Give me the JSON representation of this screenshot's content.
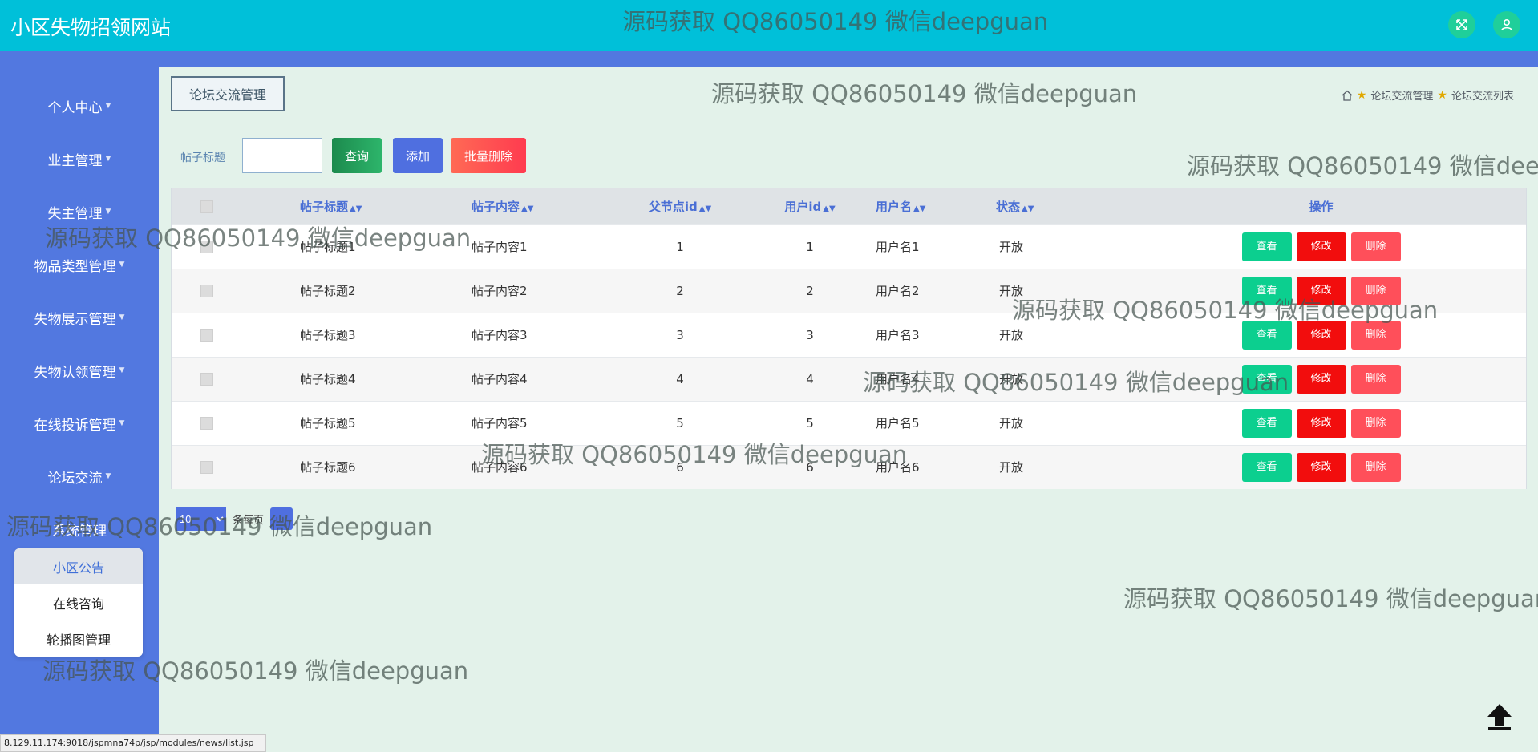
{
  "app": {
    "title": "小区失物招领网站"
  },
  "topbar": {
    "fullscreen_icon": "expand-arrows-icon",
    "user_icon": "user-icon"
  },
  "sidebar": {
    "items": [
      {
        "label": "个人中心"
      },
      {
        "label": "业主管理"
      },
      {
        "label": "失主管理"
      },
      {
        "label": "物品类型管理"
      },
      {
        "label": "失物展示管理"
      },
      {
        "label": "失物认领管理"
      },
      {
        "label": "在线投诉管理"
      },
      {
        "label": "论坛交流"
      },
      {
        "label": "系统管理"
      }
    ],
    "submenu": [
      {
        "label": "小区公告"
      },
      {
        "label": "在线咨询"
      },
      {
        "label": "轮播图管理"
      }
    ]
  },
  "page": {
    "tab": "论坛交流管理",
    "breadcrumb": [
      "论坛交流管理",
      "论坛交流列表"
    ]
  },
  "search": {
    "label": "帖子标题",
    "value": "",
    "query_button": "查询",
    "add_button": "添加",
    "batch_delete_button": "批量删除"
  },
  "table": {
    "columns": [
      "帖子标题",
      "帖子内容",
      "父节点id",
      "用户id",
      "用户名",
      "状态",
      "操作"
    ],
    "rows": [
      {
        "title": "帖子标题1",
        "content": "帖子内容1",
        "parentid": "1",
        "userid": "1",
        "username": "用户名1",
        "status": "开放"
      },
      {
        "title": "帖子标题2",
        "content": "帖子内容2",
        "parentid": "2",
        "userid": "2",
        "username": "用户名2",
        "status": "开放"
      },
      {
        "title": "帖子标题3",
        "content": "帖子内容3",
        "parentid": "3",
        "userid": "3",
        "username": "用户名3",
        "status": "开放"
      },
      {
        "title": "帖子标题4",
        "content": "帖子内容4",
        "parentid": "4",
        "userid": "4",
        "username": "用户名4",
        "status": "开放"
      },
      {
        "title": "帖子标题5",
        "content": "帖子内容5",
        "parentid": "5",
        "userid": "5",
        "username": "用户名5",
        "status": "开放"
      },
      {
        "title": "帖子标题6",
        "content": "帖子内容6",
        "parentid": "6",
        "userid": "6",
        "username": "用户名6",
        "status": "开放"
      }
    ],
    "actions": {
      "view": "查看",
      "edit": "修改",
      "delete": "删除"
    }
  },
  "pagination": {
    "page_size": "10",
    "text": "条每页"
  },
  "status_bar": {
    "url": "8.129.11.174:9018/jspmna74p/jsp/modules/news/list.jsp"
  },
  "watermark": "源码获取 QQ86050149 微信deepguan",
  "colors": {
    "topbar": "#00c0d9",
    "sidebar": "#5278e0",
    "background": "#e3f2ea",
    "view": "#0ccf8f",
    "edit": "#f20d0d",
    "delete": "#ff4f5a"
  }
}
